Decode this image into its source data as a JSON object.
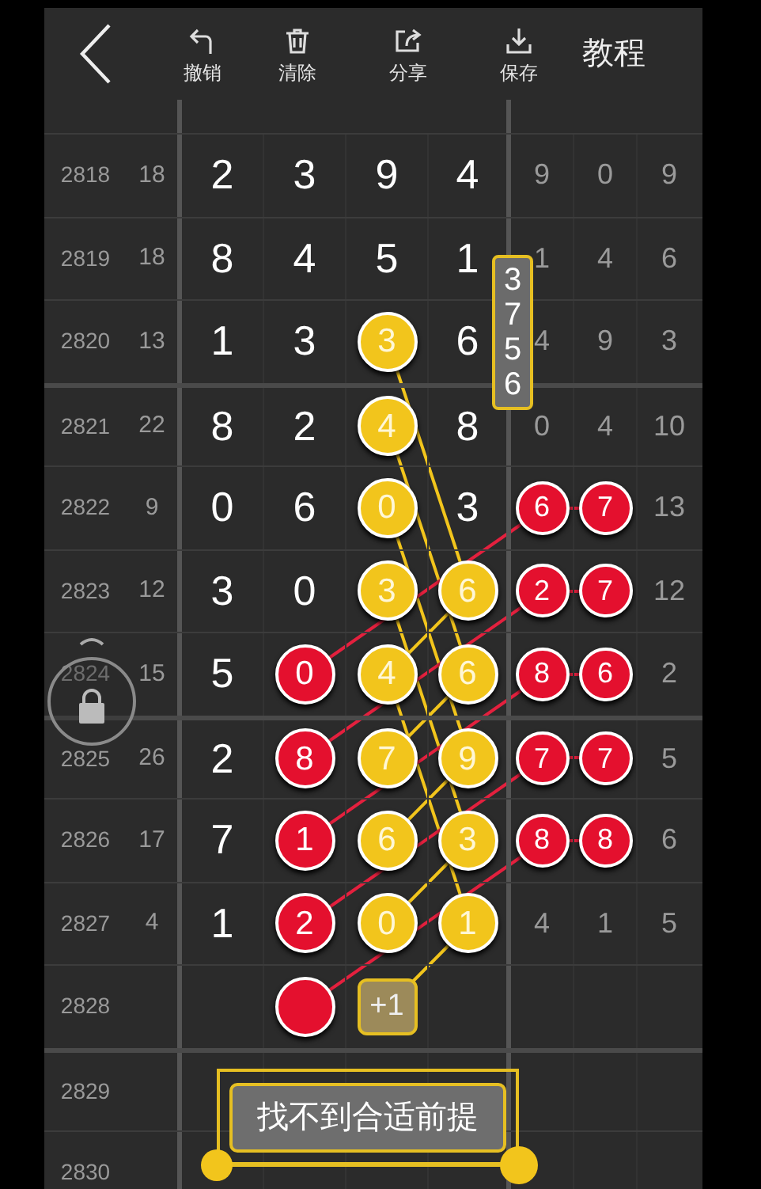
{
  "toolbar": {
    "buttons": [
      {
        "label": "撤销"
      },
      {
        "label": "清除"
      },
      {
        "label": "分享"
      },
      {
        "label": "保存"
      }
    ],
    "tutorial": "教程"
  },
  "rows": [
    {
      "period": "2818",
      "sum": "18",
      "digits": [
        {
          "kind": "plain",
          "text": "2"
        },
        {
          "kind": "plain",
          "text": "3"
        },
        {
          "kind": "plain",
          "text": "9"
        },
        {
          "kind": "plain",
          "text": "4"
        }
      ],
      "stats": [
        {
          "kind": "plain",
          "text": "9"
        },
        {
          "kind": "plain",
          "text": "0"
        },
        {
          "kind": "plain",
          "text": "9"
        }
      ]
    },
    {
      "period": "2819",
      "sum": "18",
      "digits": [
        {
          "kind": "plain",
          "text": "8"
        },
        {
          "kind": "plain",
          "text": "4"
        },
        {
          "kind": "plain",
          "text": "5"
        },
        {
          "kind": "plain",
          "text": "1"
        }
      ],
      "stats": [
        {
          "kind": "plain",
          "text": "1"
        },
        {
          "kind": "plain",
          "text": "4"
        },
        {
          "kind": "plain",
          "text": "6"
        }
      ]
    },
    {
      "period": "2820",
      "sum": "13",
      "digits": [
        {
          "kind": "plain",
          "text": "1"
        },
        {
          "kind": "plain",
          "text": "3"
        },
        {
          "kind": "yellow_ball",
          "text": "3"
        },
        {
          "kind": "plain",
          "text": "6"
        }
      ],
      "stats": [
        {
          "kind": "plain",
          "text": "4"
        },
        {
          "kind": "plain",
          "text": "9"
        },
        {
          "kind": "plain",
          "text": "3"
        }
      ]
    },
    {
      "period": "2821",
      "sum": "22",
      "digits": [
        {
          "kind": "plain",
          "text": "8"
        },
        {
          "kind": "plain",
          "text": "2"
        },
        {
          "kind": "yellow_ball",
          "text": "4"
        },
        {
          "kind": "plain",
          "text": "8"
        }
      ],
      "stats": [
        {
          "kind": "plain",
          "text": "0"
        },
        {
          "kind": "plain",
          "text": "4"
        },
        {
          "kind": "plain",
          "text": "10"
        }
      ]
    },
    {
      "period": "2822",
      "sum": "9",
      "digits": [
        {
          "kind": "plain",
          "text": "0"
        },
        {
          "kind": "plain",
          "text": "6"
        },
        {
          "kind": "yellow_ball",
          "text": "0"
        },
        {
          "kind": "plain",
          "text": "3"
        }
      ],
      "stats": [
        {
          "kind": "red_ball",
          "text": "6"
        },
        {
          "kind": "red_ball",
          "text": "7"
        },
        {
          "kind": "plain",
          "text": "13"
        }
      ]
    },
    {
      "period": "2823",
      "sum": "12",
      "digits": [
        {
          "kind": "plain",
          "text": "3"
        },
        {
          "kind": "plain",
          "text": "0"
        },
        {
          "kind": "yellow_ball",
          "text": "3"
        },
        {
          "kind": "yellow_ball",
          "text": "6"
        }
      ],
      "stats": [
        {
          "kind": "red_ball",
          "text": "2"
        },
        {
          "kind": "red_ball",
          "text": "7"
        },
        {
          "kind": "plain",
          "text": "12"
        }
      ]
    },
    {
      "period": "2824",
      "sum": "15",
      "digits": [
        {
          "kind": "plain",
          "text": "5"
        },
        {
          "kind": "red_ball",
          "text": "0"
        },
        {
          "kind": "yellow_ball",
          "text": "4"
        },
        {
          "kind": "yellow_ball",
          "text": "6"
        }
      ],
      "stats": [
        {
          "kind": "red_ball",
          "text": "8"
        },
        {
          "kind": "red_ball",
          "text": "6"
        },
        {
          "kind": "plain",
          "text": "2"
        }
      ]
    },
    {
      "period": "2825",
      "sum": "26",
      "digits": [
        {
          "kind": "plain",
          "text": "2"
        },
        {
          "kind": "red_ball",
          "text": "8"
        },
        {
          "kind": "yellow_ball",
          "text": "7"
        },
        {
          "kind": "yellow_ball",
          "text": "9"
        }
      ],
      "stats": [
        {
          "kind": "red_ball",
          "text": "7"
        },
        {
          "kind": "red_ball",
          "text": "7"
        },
        {
          "kind": "plain",
          "text": "5"
        }
      ]
    },
    {
      "period": "2826",
      "sum": "17",
      "digits": [
        {
          "kind": "plain",
          "text": "7"
        },
        {
          "kind": "red_ball",
          "text": "1"
        },
        {
          "kind": "yellow_ball",
          "text": "6"
        },
        {
          "kind": "yellow_ball",
          "text": "3"
        }
      ],
      "stats": [
        {
          "kind": "red_ball",
          "text": "8"
        },
        {
          "kind": "red_ball",
          "text": "8"
        },
        {
          "kind": "plain",
          "text": "6"
        }
      ]
    },
    {
      "period": "2827",
      "sum": "4",
      "digits": [
        {
          "kind": "plain",
          "text": "1"
        },
        {
          "kind": "red_ball",
          "text": "2"
        },
        {
          "kind": "yellow_ball",
          "text": "0"
        },
        {
          "kind": "yellow_ball",
          "text": "1"
        }
      ],
      "stats": [
        {
          "kind": "plain",
          "text": "4"
        },
        {
          "kind": "plain",
          "text": "1"
        },
        {
          "kind": "plain",
          "text": "5"
        }
      ]
    },
    {
      "period": "2828",
      "digits": [
        {
          "kind": "empty"
        },
        {
          "kind": "red_ball"
        },
        {
          "kind": "badge",
          "text": "+1"
        },
        {
          "kind": "empty"
        }
      ]
    },
    {
      "period": "2829"
    },
    {
      "period": "2830"
    }
  ],
  "vertical_label": "3756",
  "prompt": "找不到合适前提"
}
